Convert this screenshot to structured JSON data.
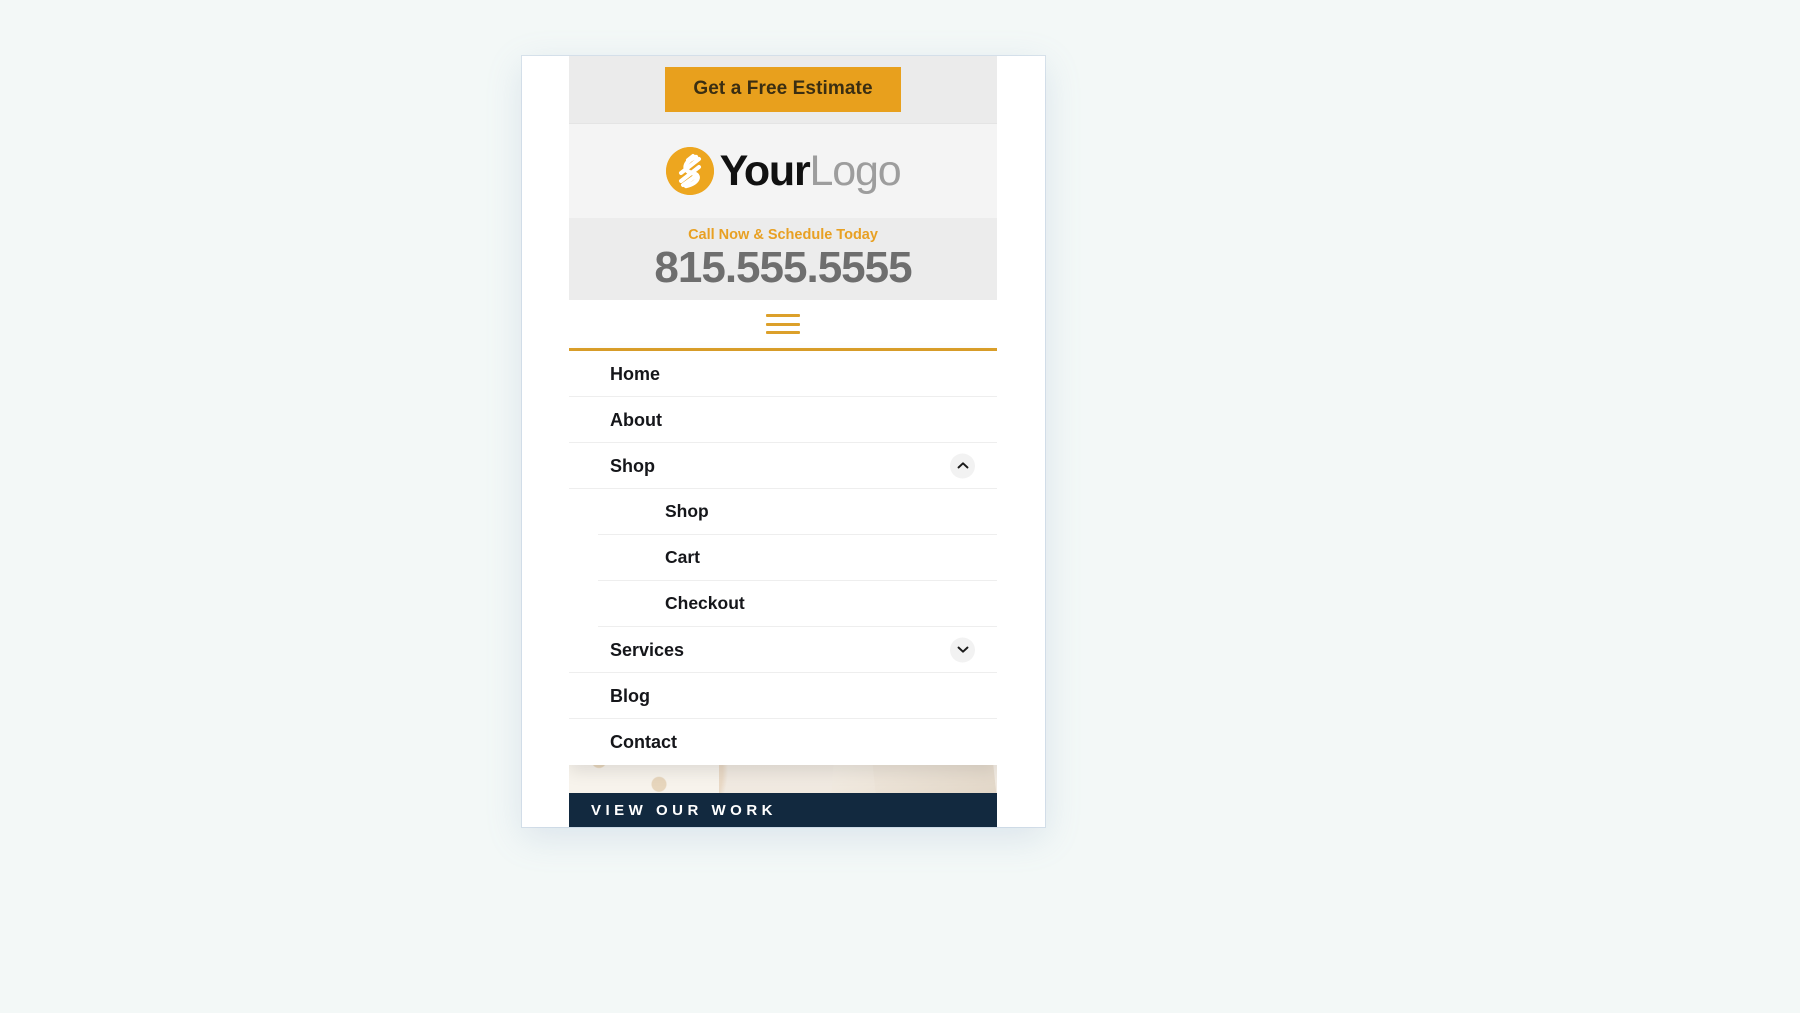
{
  "page": {
    "background_color": "#f3f8f7",
    "accent_color": "#e8a01d",
    "device_background": "#ffffff"
  },
  "topbar": {
    "estimate_label": "Get a Free Estimate"
  },
  "logo": {
    "mark_name": "yourlogo-swoosh-icon",
    "mark_color": "#eda61f",
    "text_primary": "Your",
    "text_secondary": "Logo"
  },
  "contact": {
    "tagline": "Call Now & Schedule Today",
    "tagline_color": "#e8a023",
    "phone": "815.555.5555",
    "phone_color": "#6e6e6e"
  },
  "nav": {
    "hamburger_name": "hamburger-menu-icon",
    "hamburger_color": "#dca02a",
    "items": [
      {
        "label": "Home",
        "has_toggle": false,
        "toggle": ""
      },
      {
        "label": "About",
        "has_toggle": false,
        "toggle": ""
      },
      {
        "label": "Shop",
        "has_toggle": true,
        "toggle": "chevron-up-icon",
        "expanded": true
      },
      {
        "label": "Services",
        "has_toggle": true,
        "toggle": "chevron-down-icon",
        "expanded": false
      },
      {
        "label": "Blog",
        "has_toggle": false,
        "toggle": ""
      },
      {
        "label": "Contact",
        "has_toggle": false,
        "toggle": ""
      }
    ],
    "shop_submenu": [
      {
        "label": "Shop"
      },
      {
        "label": "Cart"
      },
      {
        "label": "Checkout"
      }
    ]
  },
  "hero": {
    "work_band_text": "VIEW OUR WORK",
    "work_band_color": "#12293f"
  }
}
